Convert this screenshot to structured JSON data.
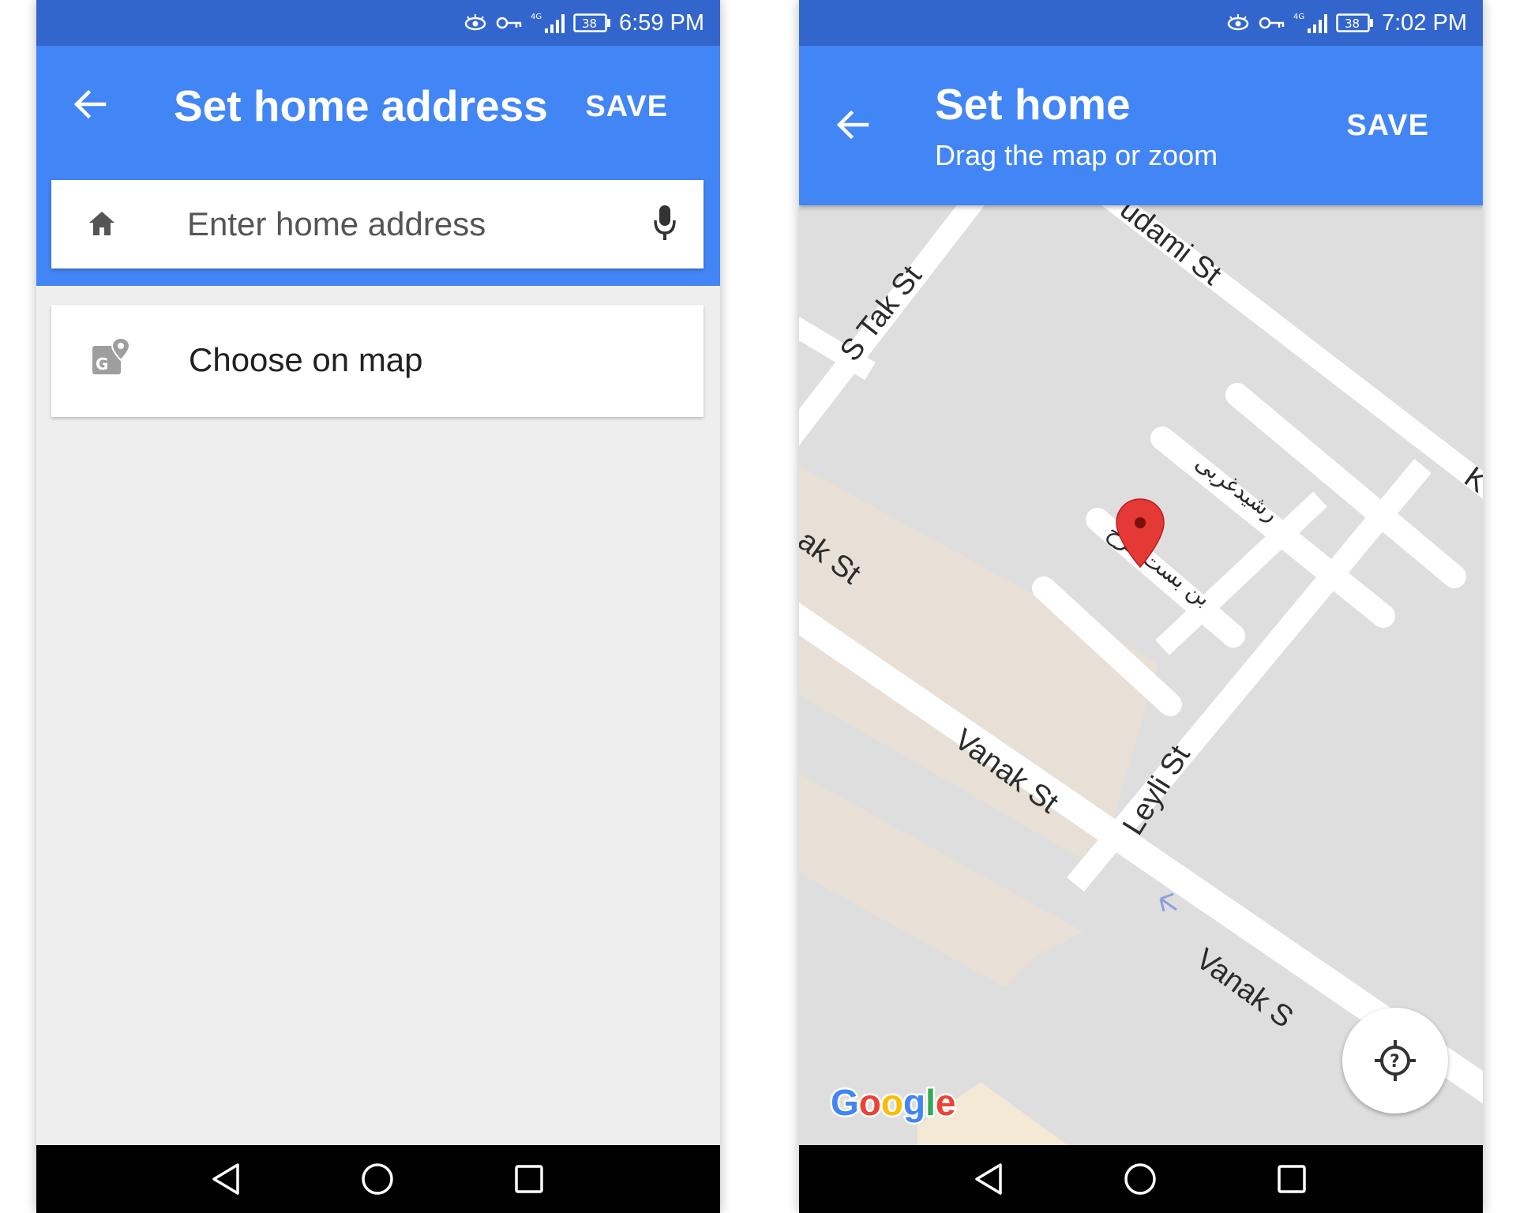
{
  "left_screen": {
    "status_time": "6:59 PM",
    "battery": "38",
    "title": "Set home address",
    "save_label": "SAVE",
    "search": {
      "placeholder": "Enter home address",
      "value": ""
    },
    "choose_on_map_label": "Choose on map"
  },
  "right_screen": {
    "status_time": "7:02 PM",
    "battery": "38",
    "title": "Set home",
    "subtitle": "Drag the map or zoom",
    "save_label": "SAVE",
    "map": {
      "street_labels": {
        "udami": "udami St",
        "s_tak": "S Tak St",
        "vanak_1": "ak St",
        "vanak_2": "Vanak St",
        "vanak_3": "Vanak S",
        "leyli": "Leyli St",
        "rashid": "رشیدغربی",
        "bonbast": "بن بست فرخ",
        "k_edge": "K"
      },
      "google_logo": [
        "G",
        "o",
        "o",
        "g",
        "l",
        "e"
      ],
      "logo_colors": [
        "#4285f4",
        "#ea4335",
        "#fbbc05",
        "#4285f4",
        "#34a853",
        "#ea4335"
      ]
    }
  },
  "colors": {
    "status_bar": "#3366cc",
    "app_bar": "#4285f4",
    "map_background": "#dedede",
    "park_area": "#e8e0d6",
    "pin": "#e53935"
  }
}
